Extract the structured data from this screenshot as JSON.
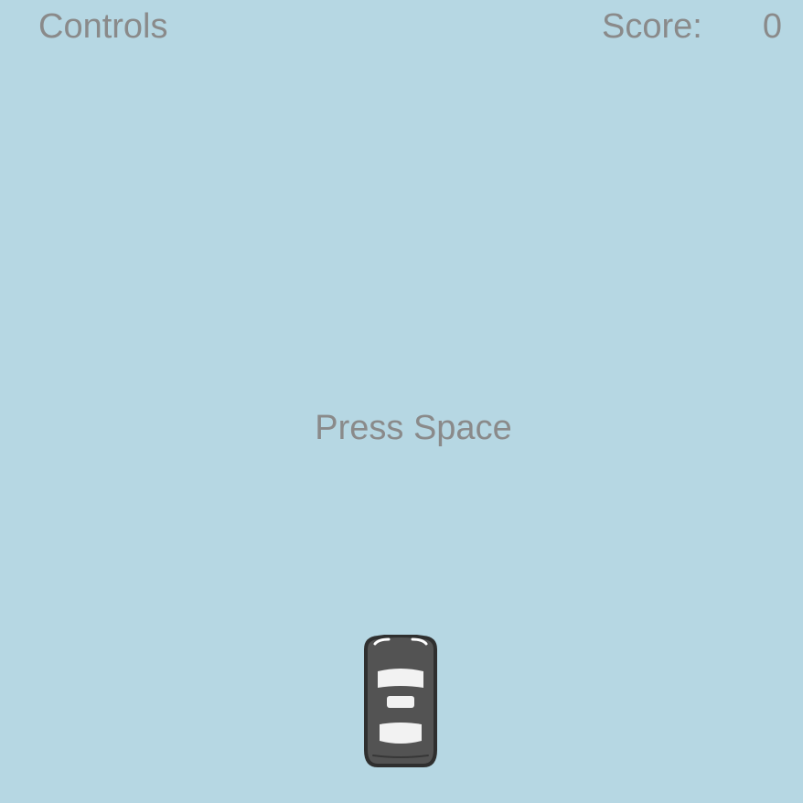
{
  "colors": {
    "background": "#b6d7e3",
    "hud_text": "#8a8a8a",
    "car_body": "#535353",
    "car_outline": "#2f2f2f",
    "car_window": "#f2f2f2"
  },
  "hud": {
    "controls_label": "Controls",
    "score_label": "Score:",
    "score_value": "0"
  },
  "prompt": {
    "text": "Press Space"
  },
  "player_car": {
    "icon": "car-icon"
  }
}
